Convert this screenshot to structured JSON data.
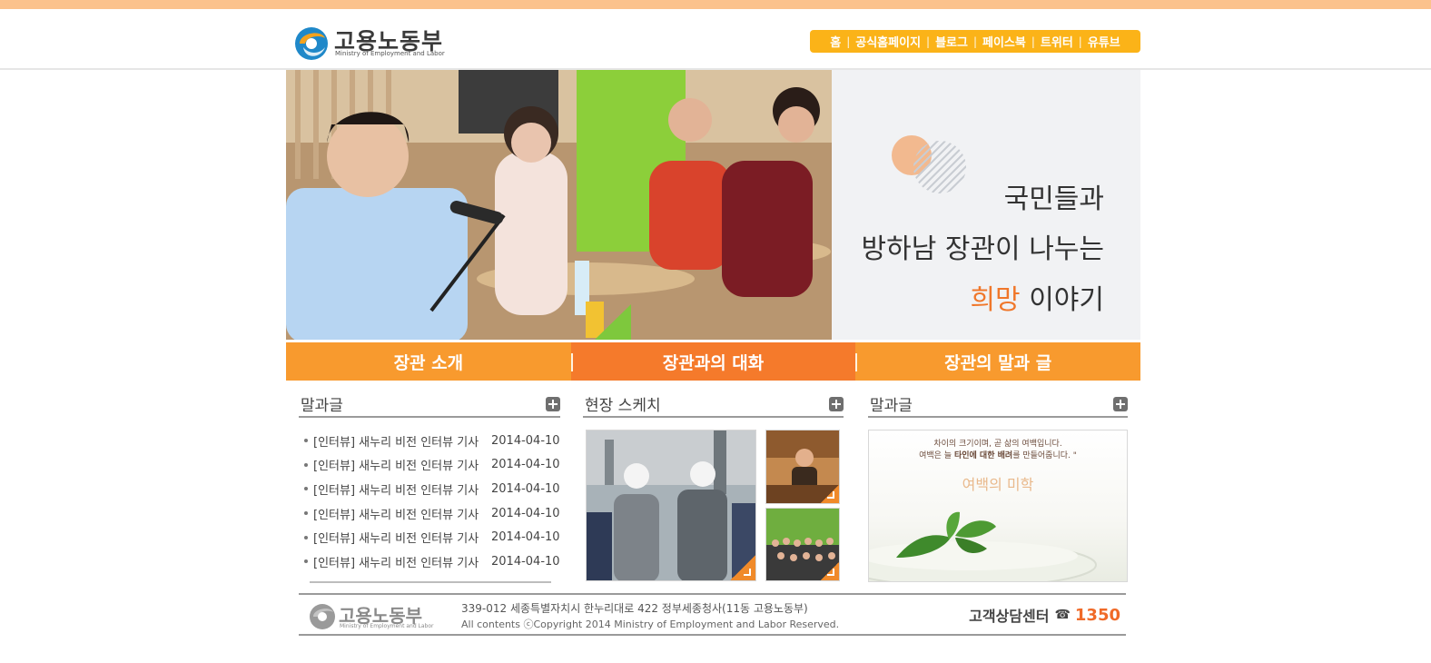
{
  "header": {
    "logo_ko": "고용노동부",
    "logo_en": "Ministry of Employment and Labor",
    "links": [
      "홈",
      "공식홈페이지",
      "블로그",
      "페이스북",
      "트위터",
      "유튜브"
    ]
  },
  "hero": {
    "line1": "국민들과",
    "line2": "방하남 장관이 나누는",
    "line3_highlight": "희망",
    "line3_rest": " 이야기"
  },
  "tabs": [
    {
      "label": "장관 소개",
      "active": false
    },
    {
      "label": "장관과의 대화",
      "active": true
    },
    {
      "label": "장관의 말과 글",
      "active": false
    }
  ],
  "col1": {
    "title": "말과글",
    "items": [
      {
        "title": "[인터뷰] 새누리 비전 인터뷰 기사",
        "date": "2014-04-10"
      },
      {
        "title": "[인터뷰] 새누리 비전 인터뷰 기사",
        "date": "2014-04-10"
      },
      {
        "title": "[인터뷰] 새누리 비전 인터뷰 기사",
        "date": "2014-04-10"
      },
      {
        "title": "[인터뷰] 새누리 비전 인터뷰 기사",
        "date": "2014-04-10"
      },
      {
        "title": "[인터뷰] 새누리 비전 인터뷰 기사",
        "date": "2014-04-10"
      },
      {
        "title": "[인터뷰] 새누리 비전 인터뷰 기사",
        "date": "2014-04-10"
      }
    ]
  },
  "col2": {
    "title": "현장 스케치"
  },
  "col3": {
    "title": "말과글",
    "quote_line1": "차이의 크기이며, 곧 삶의 여백입니다.",
    "quote_line2_pre": "여백은 늘 ",
    "quote_line2_bold": "타인에 대한 배려",
    "quote_line2_post": "를 만들어줍니다. \"",
    "quote_title": "여백의 미학"
  },
  "footer": {
    "logo_ko": "고용노동부",
    "logo_en": "Ministry of Employment and Labor",
    "address": "339-012 세종특별자치시 한누리대로 422 정부세종청사(11동 고용노동부)",
    "copyright": "All contents ⓒCopyright 2014 Ministry of Employment and Labor Reserved.",
    "center_label": "고객상담센터",
    "phone_icon": "☎",
    "phone": "1350"
  },
  "colors": {
    "accent_orange": "#f89a2e",
    "active_orange": "#f57a2b",
    "link_bar_yellow": "#fbb318",
    "phone_red": "#f06a28"
  }
}
